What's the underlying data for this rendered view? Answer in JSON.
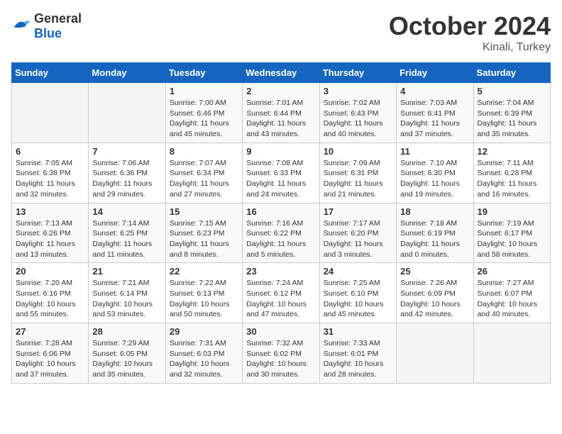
{
  "header": {
    "logo_general": "General",
    "logo_blue": "Blue",
    "title": "October 2024",
    "location": "Kinali, Turkey"
  },
  "days_of_week": [
    "Sunday",
    "Monday",
    "Tuesday",
    "Wednesday",
    "Thursday",
    "Friday",
    "Saturday"
  ],
  "weeks": [
    [
      {
        "day": "",
        "sunrise": "",
        "sunset": "",
        "daylight": ""
      },
      {
        "day": "",
        "sunrise": "",
        "sunset": "",
        "daylight": ""
      },
      {
        "day": "1",
        "sunrise": "Sunrise: 7:00 AM",
        "sunset": "Sunset: 6:46 PM",
        "daylight": "Daylight: 11 hours and 45 minutes."
      },
      {
        "day": "2",
        "sunrise": "Sunrise: 7:01 AM",
        "sunset": "Sunset: 6:44 PM",
        "daylight": "Daylight: 11 hours and 43 minutes."
      },
      {
        "day": "3",
        "sunrise": "Sunrise: 7:02 AM",
        "sunset": "Sunset: 6:43 PM",
        "daylight": "Daylight: 11 hours and 40 minutes."
      },
      {
        "day": "4",
        "sunrise": "Sunrise: 7:03 AM",
        "sunset": "Sunset: 6:41 PM",
        "daylight": "Daylight: 11 hours and 37 minutes."
      },
      {
        "day": "5",
        "sunrise": "Sunrise: 7:04 AM",
        "sunset": "Sunset: 6:39 PM",
        "daylight": "Daylight: 11 hours and 35 minutes."
      }
    ],
    [
      {
        "day": "6",
        "sunrise": "Sunrise: 7:05 AM",
        "sunset": "Sunset: 6:38 PM",
        "daylight": "Daylight: 11 hours and 32 minutes."
      },
      {
        "day": "7",
        "sunrise": "Sunrise: 7:06 AM",
        "sunset": "Sunset: 6:36 PM",
        "daylight": "Daylight: 11 hours and 29 minutes."
      },
      {
        "day": "8",
        "sunrise": "Sunrise: 7:07 AM",
        "sunset": "Sunset: 6:34 PM",
        "daylight": "Daylight: 11 hours and 27 minutes."
      },
      {
        "day": "9",
        "sunrise": "Sunrise: 7:08 AM",
        "sunset": "Sunset: 6:33 PM",
        "daylight": "Daylight: 11 hours and 24 minutes."
      },
      {
        "day": "10",
        "sunrise": "Sunrise: 7:09 AM",
        "sunset": "Sunset: 6:31 PM",
        "daylight": "Daylight: 11 hours and 21 minutes."
      },
      {
        "day": "11",
        "sunrise": "Sunrise: 7:10 AM",
        "sunset": "Sunset: 6:30 PM",
        "daylight": "Daylight: 11 hours and 19 minutes."
      },
      {
        "day": "12",
        "sunrise": "Sunrise: 7:11 AM",
        "sunset": "Sunset: 6:28 PM",
        "daylight": "Daylight: 11 hours and 16 minutes."
      }
    ],
    [
      {
        "day": "13",
        "sunrise": "Sunrise: 7:13 AM",
        "sunset": "Sunset: 6:26 PM",
        "daylight": "Daylight: 11 hours and 13 minutes."
      },
      {
        "day": "14",
        "sunrise": "Sunrise: 7:14 AM",
        "sunset": "Sunset: 6:25 PM",
        "daylight": "Daylight: 11 hours and 11 minutes."
      },
      {
        "day": "15",
        "sunrise": "Sunrise: 7:15 AM",
        "sunset": "Sunset: 6:23 PM",
        "daylight": "Daylight: 11 hours and 8 minutes."
      },
      {
        "day": "16",
        "sunrise": "Sunrise: 7:16 AM",
        "sunset": "Sunset: 6:22 PM",
        "daylight": "Daylight: 11 hours and 5 minutes."
      },
      {
        "day": "17",
        "sunrise": "Sunrise: 7:17 AM",
        "sunset": "Sunset: 6:20 PM",
        "daylight": "Daylight: 11 hours and 3 minutes."
      },
      {
        "day": "18",
        "sunrise": "Sunrise: 7:18 AM",
        "sunset": "Sunset: 6:19 PM",
        "daylight": "Daylight: 11 hours and 0 minutes."
      },
      {
        "day": "19",
        "sunrise": "Sunrise: 7:19 AM",
        "sunset": "Sunset: 6:17 PM",
        "daylight": "Daylight: 10 hours and 58 minutes."
      }
    ],
    [
      {
        "day": "20",
        "sunrise": "Sunrise: 7:20 AM",
        "sunset": "Sunset: 6:16 PM",
        "daylight": "Daylight: 10 hours and 55 minutes."
      },
      {
        "day": "21",
        "sunrise": "Sunrise: 7:21 AM",
        "sunset": "Sunset: 6:14 PM",
        "daylight": "Daylight: 10 hours and 53 minutes."
      },
      {
        "day": "22",
        "sunrise": "Sunrise: 7:22 AM",
        "sunset": "Sunset: 6:13 PM",
        "daylight": "Daylight: 10 hours and 50 minutes."
      },
      {
        "day": "23",
        "sunrise": "Sunrise: 7:24 AM",
        "sunset": "Sunset: 6:12 PM",
        "daylight": "Daylight: 10 hours and 47 minutes."
      },
      {
        "day": "24",
        "sunrise": "Sunrise: 7:25 AM",
        "sunset": "Sunset: 6:10 PM",
        "daylight": "Daylight: 10 hours and 45 minutes."
      },
      {
        "day": "25",
        "sunrise": "Sunrise: 7:26 AM",
        "sunset": "Sunset: 6:09 PM",
        "daylight": "Daylight: 10 hours and 42 minutes."
      },
      {
        "day": "26",
        "sunrise": "Sunrise: 7:27 AM",
        "sunset": "Sunset: 6:07 PM",
        "daylight": "Daylight: 10 hours and 40 minutes."
      }
    ],
    [
      {
        "day": "27",
        "sunrise": "Sunrise: 7:28 AM",
        "sunset": "Sunset: 6:06 PM",
        "daylight": "Daylight: 10 hours and 37 minutes."
      },
      {
        "day": "28",
        "sunrise": "Sunrise: 7:29 AM",
        "sunset": "Sunset: 6:05 PM",
        "daylight": "Daylight: 10 hours and 35 minutes."
      },
      {
        "day": "29",
        "sunrise": "Sunrise: 7:31 AM",
        "sunset": "Sunset: 6:03 PM",
        "daylight": "Daylight: 10 hours and 32 minutes."
      },
      {
        "day": "30",
        "sunrise": "Sunrise: 7:32 AM",
        "sunset": "Sunset: 6:02 PM",
        "daylight": "Daylight: 10 hours and 30 minutes."
      },
      {
        "day": "31",
        "sunrise": "Sunrise: 7:33 AM",
        "sunset": "Sunset: 6:01 PM",
        "daylight": "Daylight: 10 hours and 28 minutes."
      },
      {
        "day": "",
        "sunrise": "",
        "sunset": "",
        "daylight": ""
      },
      {
        "day": "",
        "sunrise": "",
        "sunset": "",
        "daylight": ""
      }
    ]
  ]
}
